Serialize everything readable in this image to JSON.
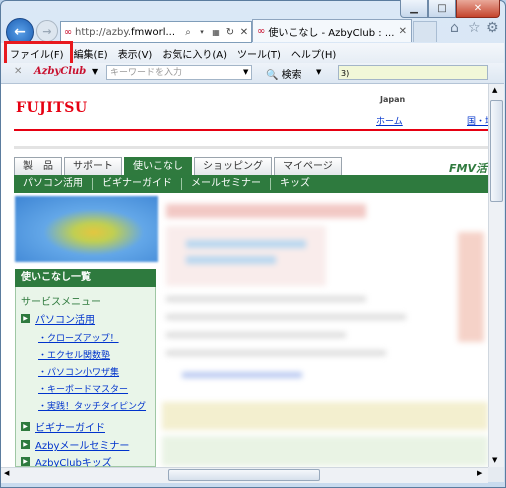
{
  "browser": {
    "address_text_prefix": "http://azby.",
    "address_text_bold": "fmworl...",
    "address_icons": [
      "search-icon",
      "dropdown-icon",
      "compat-icon",
      "refresh-icon",
      "stop-icon"
    ],
    "tab_title": "使いこなし - AzbyClub : ...",
    "tab_close": "✕",
    "window_buttons": {
      "minimize": "▁",
      "maximize": "□",
      "close": "✕"
    },
    "right_icons": [
      "home-icon",
      "star-icon",
      "gear-icon"
    ]
  },
  "menubar": {
    "items": [
      "ファイル(F)",
      "編集(E)",
      "表示(V)",
      "お気に入り(A)",
      "ツール(T)",
      "ヘルプ(H)"
    ]
  },
  "toolbar": {
    "logo": "AzbyClub",
    "search_placeholder": "キーワードを入力",
    "search_button": "検索",
    "second_box": "3)"
  },
  "page": {
    "logo": "FUJITSU",
    "region": "Japan",
    "home_link": "ホーム",
    "country_link": "国・地",
    "tabs": [
      "製　品",
      "サポート",
      "使いこなし",
      "ショッピング",
      "マイページ"
    ],
    "active_tab_index": 2,
    "brand": "FMV活",
    "subnav": [
      "パソコン活用",
      "ビギナーガイド",
      "メールセミナー",
      "キッズ"
    ],
    "sidebar": {
      "heading": "使いこなし一覧",
      "service_label": "サービスメニュー",
      "sections": [
        {
          "label": "パソコン活用",
          "icon": "arrow-square-icon"
        },
        {
          "label": "ビギナーガイド",
          "icon": "arrow-square-icon"
        },
        {
          "label": "Azbyメールセミナー",
          "icon": "arrow-square-icon"
        },
        {
          "label": "AzbyClubキッズ",
          "icon": "arrow-square-icon"
        }
      ],
      "subitems": [
        "クローズアップ！",
        "エクセル関数塾",
        "パソコン小ワザ集",
        "キーボードマスター",
        "実践！タッチタイピング"
      ]
    }
  },
  "colors": {
    "accent_green": "#2e7a3e",
    "fujitsu_red": "#e60012",
    "highlight": "#e8191e"
  }
}
